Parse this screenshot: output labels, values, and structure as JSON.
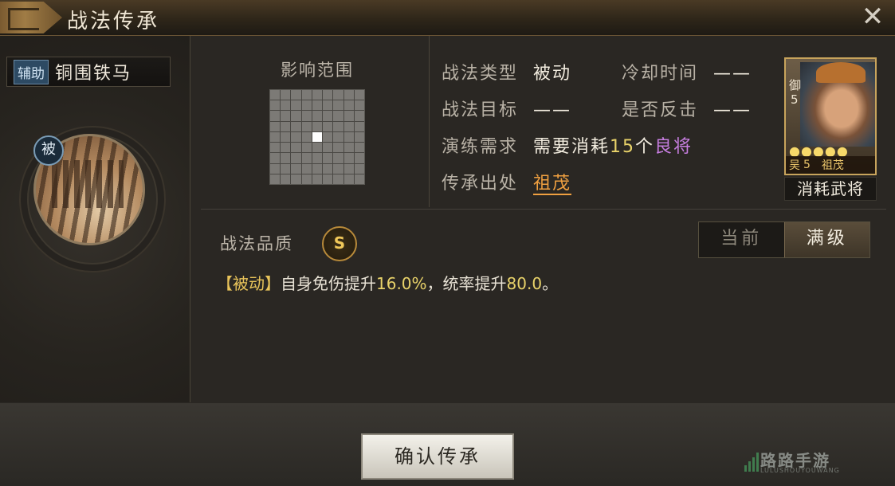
{
  "window": {
    "title": "战法传承",
    "close_label": "✕"
  },
  "skill": {
    "role_tag": "辅助",
    "name": "铜围铁马",
    "passive_badge": "被"
  },
  "range": {
    "title": "影响范围",
    "grid_size": 9,
    "highlight_cell": "center"
  },
  "info": {
    "type_label": "战法类型",
    "type_value": "被动",
    "cooldown_label": "冷却时间",
    "cooldown_value": "——",
    "target_label": "战法目标",
    "target_value": "——",
    "counter_label": "是否反击",
    "counter_value": "——",
    "drill_label": "演练需求",
    "drill_prefix": "需要消耗",
    "drill_count": "15",
    "drill_unit": "个",
    "drill_item": "良将",
    "origin_label": "传承出处",
    "origin_value": "祖茂"
  },
  "general_card": {
    "troop_type": "御",
    "cost": "5",
    "stars": "●●●●●",
    "faction": "吴",
    "level": "5",
    "name": "祖茂",
    "consume_label": "消耗武将"
  },
  "quality": {
    "label": "战法品质",
    "grade": "S"
  },
  "toggle": {
    "current_label": "当前",
    "max_label": "满级",
    "selected": "max"
  },
  "description": {
    "tag": "【被动】",
    "text_prefix": "自身免伤提升",
    "damage_reduction": "16.0%",
    "text_middle": "，统率提升",
    "command_bonus": "80.0",
    "text_suffix": "。"
  },
  "buttons": {
    "confirm": "确认传承"
  },
  "watermark": {
    "text": "路路手游",
    "sub": "LULUSHOUYOUWANG"
  },
  "colors": {
    "accent_gold": "#e9c45a",
    "highlight_purple": "#c77ee0",
    "link_orange": "#f0a040"
  }
}
